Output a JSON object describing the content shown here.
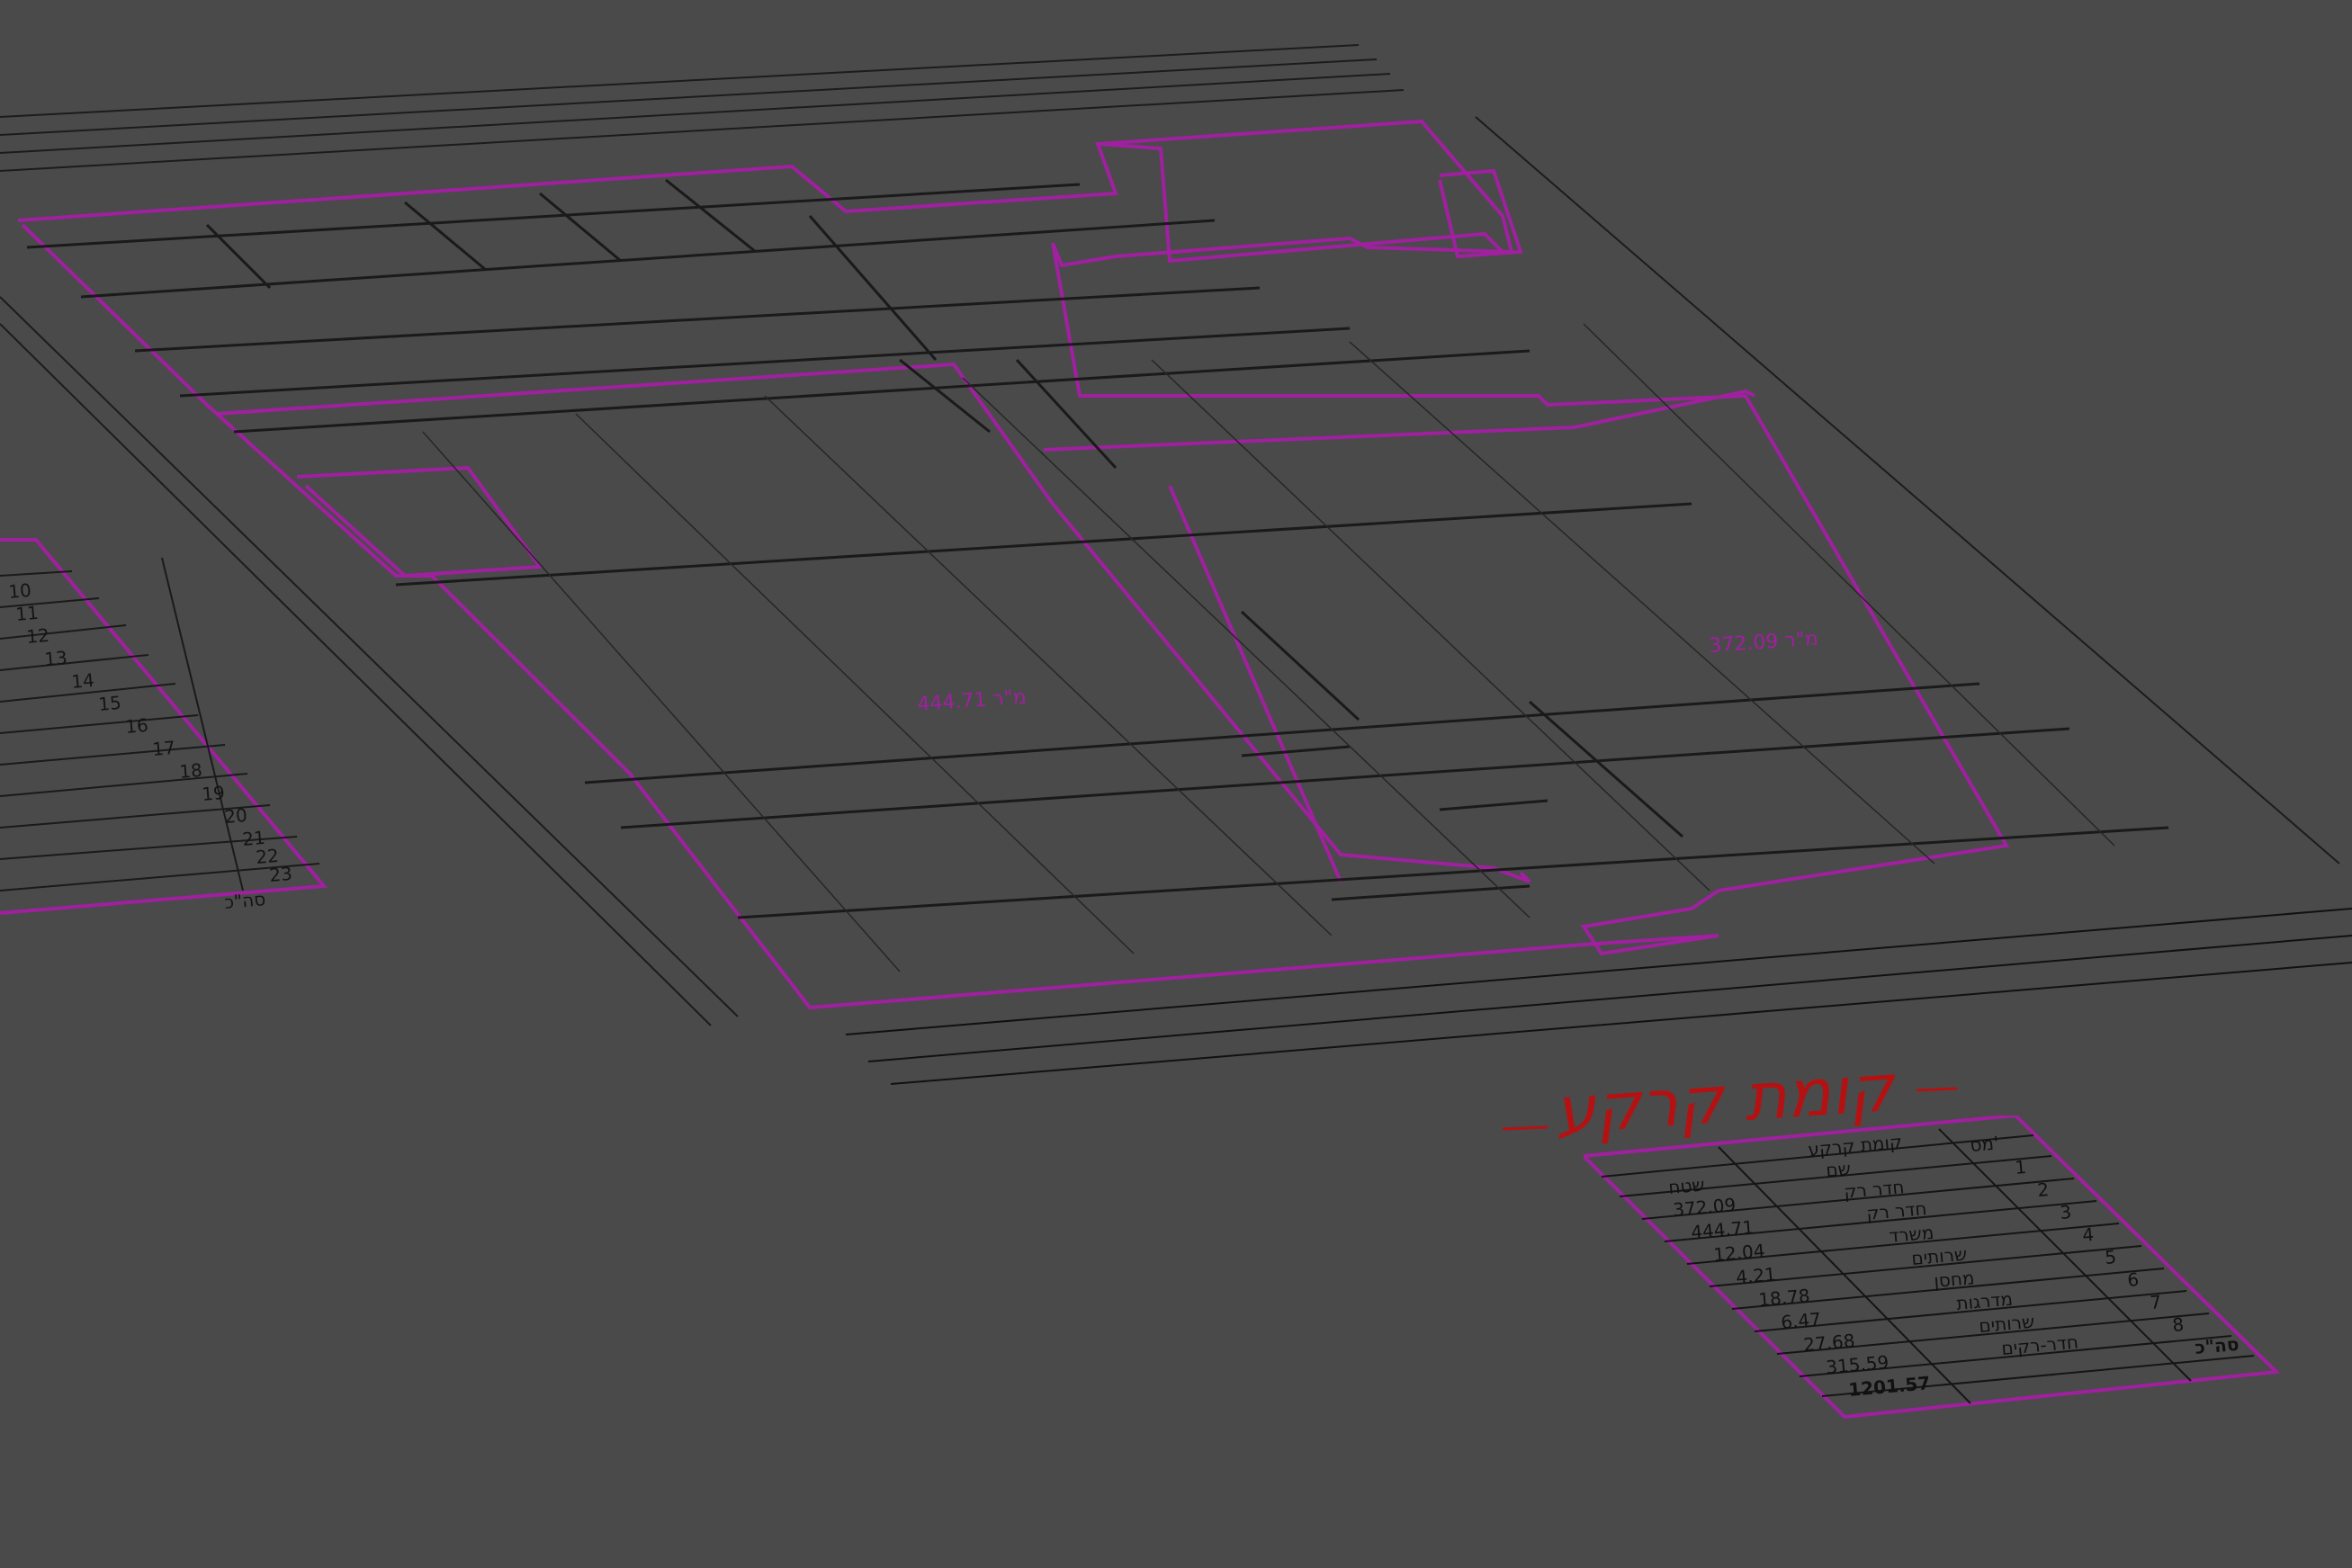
{
  "title": "קומת קרקע",
  "room_labels": [
    "מ\"ר 444.71",
    "מ\"ר 372.09"
  ],
  "area_table": {
    "header": "קומת קרקע",
    "columns": [
      "מס'",
      "שם",
      "שטח"
    ],
    "rows": [
      {
        "num": "1",
        "name": "חדר רק",
        "area": "372.09"
      },
      {
        "num": "2",
        "name": "חדר רק",
        "area": "444.71"
      },
      {
        "num": "3",
        "name": "משרד",
        "area": "12.04"
      },
      {
        "num": "4",
        "name": "שרותים",
        "area": "4.21"
      },
      {
        "num": "5",
        "name": "מחסן",
        "area": "18.78"
      },
      {
        "num": "6",
        "name": "מדרגות",
        "area": "6.47"
      },
      {
        "num": "7",
        "name": "שרותים",
        "area": "27.68"
      },
      {
        "num": "8",
        "name": "חדר-רקים",
        "area": "315.59"
      }
    ],
    "total_label": "סה\"כ",
    "total_value": "1201.57"
  },
  "left_table_rows": [
    "10",
    "11",
    "12",
    "13",
    "14",
    "15",
    "16",
    "17",
    "18",
    "19",
    "20",
    "21",
    "22",
    "23"
  ],
  "left_table_total": "סה\"כ",
  "colors": {
    "background": "#4a4a4a",
    "wall_line": "#1a1a1a",
    "room_outline": "#a020a0",
    "title": "#b41212"
  }
}
